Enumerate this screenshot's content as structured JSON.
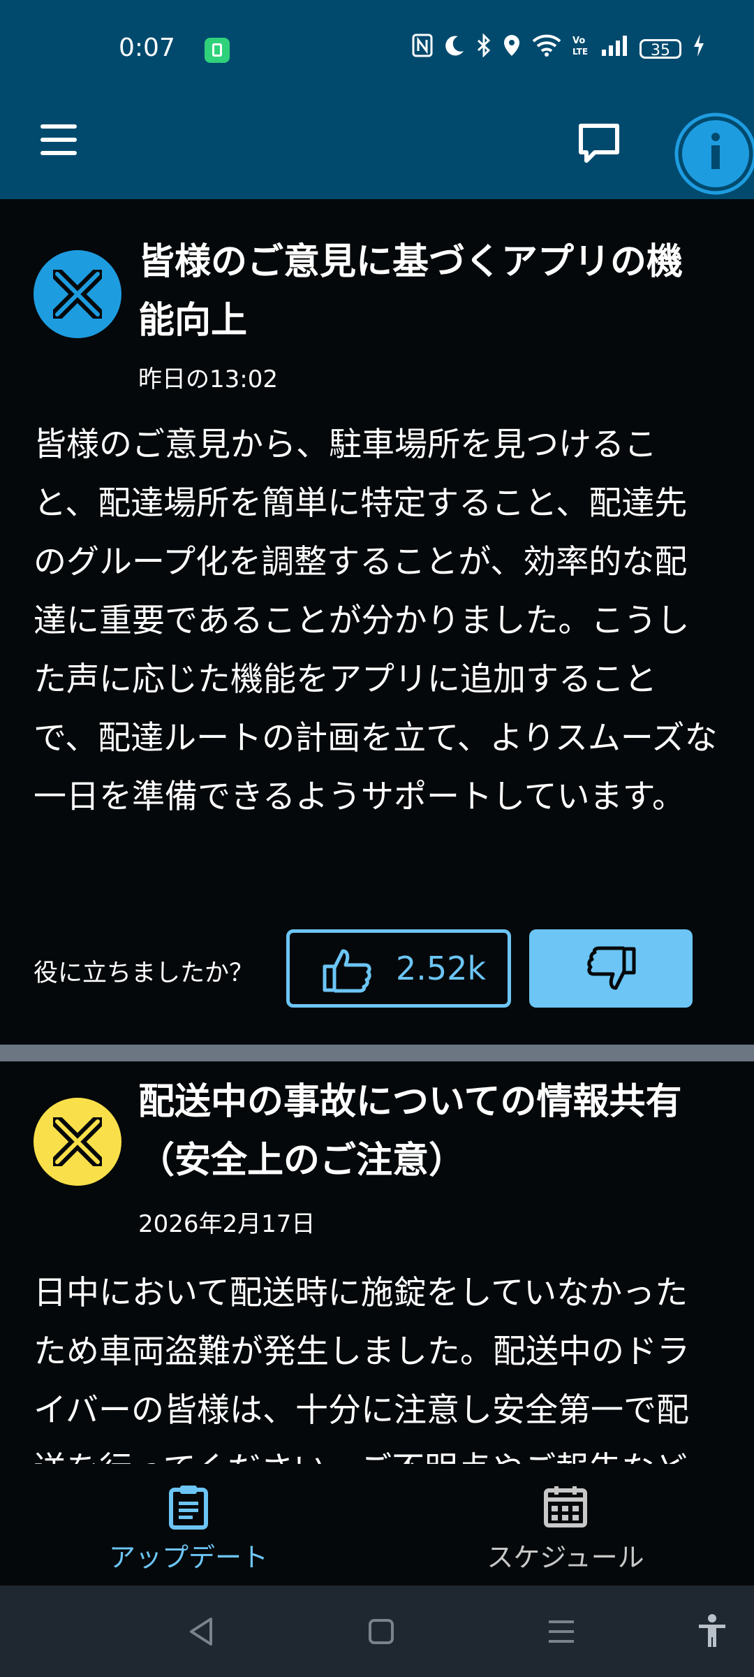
{
  "status": {
    "time": "0:07",
    "battery": "35"
  },
  "posts": [
    {
      "title": "皆様のご意見に基づくアプリの機能向上",
      "date": "昨日の13:02",
      "body": "皆様のご意見から、駐車場所を見つけること、配達場所を簡単に特定すること、配達先のグループ化を調整することが、効率的な配達に重要であることが分かりました。こうした声に応じた機能をアプリに追加することで、配達ルートの計画を立て、よりスムーズな一日を準備できるようサポートしています。",
      "avatar_color": "#1e9ce0",
      "feedback_label": "役に立ちましたか？",
      "like_count": "2.52k"
    },
    {
      "title": "配送中の事故についての情報共有（安全上のご注意）",
      "date": "2026年2月17日",
      "body": "日中において配送時に施錠をしていなかったため車両盗難が発生しました。配送中のドライバーの皆様は、十分に注意し安全第一で配送を行ってください。ご不明点やご報告など",
      "avatar_color": "#f9e04a"
    }
  ],
  "nav": {
    "updates_label": "アップデート",
    "schedule_label": "スケジュール"
  },
  "colors": {
    "header": "#014a6e",
    "accent": "#6cc5f5",
    "background": "#05080a",
    "divider": "#6c7683",
    "inactive": "#c8c8c8"
  },
  "icons": [
    "menu-icon",
    "chat-icon",
    "info-icon",
    "thumbs-up-icon",
    "thumbs-down-icon",
    "clipboard-icon",
    "calendar-icon",
    "back-icon",
    "home-icon",
    "recents-icon",
    "accessibility-icon"
  ]
}
